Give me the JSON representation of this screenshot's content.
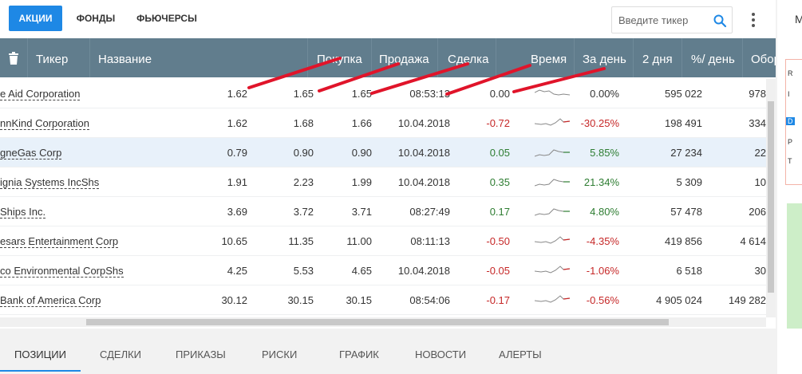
{
  "top_tabs": [
    {
      "label": "АКЦИИ",
      "active": true
    },
    {
      "label": "ФОНДЫ",
      "active": false
    },
    {
      "label": "ФЬЮЧЕРСЫ",
      "active": false
    }
  ],
  "search": {
    "placeholder": "Введите тикер"
  },
  "columns": [
    "Тикер",
    "Название",
    "Покупка",
    "Продажа",
    "Сделка",
    "Время",
    "За день",
    "2 дня",
    "%/ день",
    "Оборо"
  ],
  "rows": [
    {
      "name": "e Aid Corporation",
      "bid": "1.62",
      "ask": "1.65",
      "last": "1.65",
      "time": "08:53:13",
      "change": "0.00",
      "pct": "0.00%",
      "volume": "595 022",
      "turnover": "978",
      "trend": "flat",
      "highlight": false
    },
    {
      "name": "nnKind Corporation",
      "bid": "1.62",
      "ask": "1.68",
      "last": "1.66",
      "time": "10.04.2018",
      "change": "-0.72",
      "pct": "-30.25%",
      "volume": "198 491",
      "turnover": "334",
      "trend": "neg",
      "highlight": false
    },
    {
      "name": "gneGas Corp",
      "bid": "0.79",
      "ask": "0.90",
      "last": "0.90",
      "time": "10.04.2018",
      "change": "0.05",
      "pct": "5.85%",
      "volume": "27 234",
      "turnover": "22",
      "trend": "pos",
      "highlight": true
    },
    {
      "name": "ignia Systems IncShs",
      "bid": "1.91",
      "ask": "2.23",
      "last": "1.99",
      "time": "10.04.2018",
      "change": "0.35",
      "pct": "21.34%",
      "volume": "5 309",
      "turnover": "10",
      "trend": "pos",
      "highlight": false
    },
    {
      "name": "Ships Inc.",
      "bid": "3.69",
      "ask": "3.72",
      "last": "3.71",
      "time": "08:27:49",
      "change": "0.17",
      "pct": "4.80%",
      "volume": "57 478",
      "turnover": "206",
      "trend": "pos",
      "highlight": false
    },
    {
      "name": "esars Entertainment Corp",
      "bid": "10.65",
      "ask": "11.35",
      "last": "11.00",
      "time": "08:11:13",
      "change": "-0.50",
      "pct": "-4.35%",
      "volume": "419 856",
      "turnover": "4 614",
      "trend": "neg",
      "highlight": false
    },
    {
      "name": "co Environmental CorpShs",
      "bid": "4.25",
      "ask": "5.53",
      "last": "4.65",
      "time": "10.04.2018",
      "change": "-0.05",
      "pct": "-1.06%",
      "volume": "6 518",
      "turnover": "30",
      "trend": "neg",
      "highlight": false
    },
    {
      "name": "Bank of America Corp",
      "bid": "30.12",
      "ask": "30.15",
      "last": "30.15",
      "time": "08:54:06",
      "change": "-0.17",
      "pct": "-0.56%",
      "volume": "4 905 024",
      "turnover": "149 282",
      "trend": "neg",
      "highlight": false
    }
  ],
  "bottom_tabs": [
    {
      "label": "ПОЗИЦИИ",
      "active": true
    },
    {
      "label": "СДЕЛКИ",
      "active": false
    },
    {
      "label": "ПРИКАЗЫ",
      "active": false
    },
    {
      "label": "РИСКИ",
      "active": false
    },
    {
      "label": "ГРАФИК",
      "active": false
    },
    {
      "label": "НОВОСТИ",
      "active": false
    },
    {
      "label": "АЛЕРТЫ",
      "active": false
    }
  ],
  "right_strip": {
    "top_letter": "М",
    "letters": [
      "R",
      "I",
      "D",
      "P",
      "T"
    ]
  },
  "colors": {
    "accent": "#1e88e5",
    "header_bg": "#617d8d",
    "negative": "#c62828",
    "positive": "#2e7d32",
    "annotation": "#e0142a"
  }
}
